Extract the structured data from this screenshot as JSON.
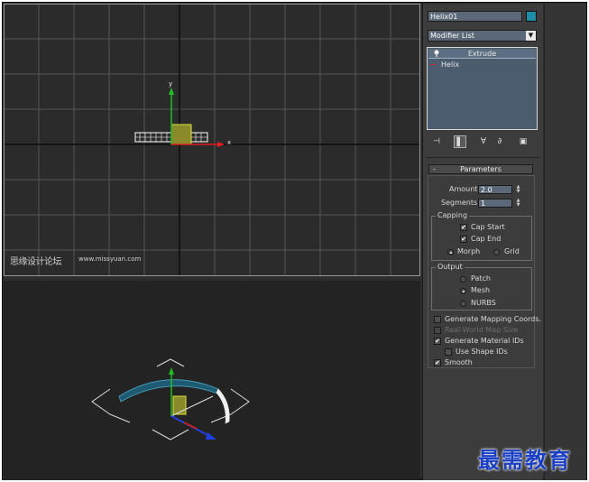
{
  "viewports": {
    "top": {
      "watermark_cn": "思缘设计论坛",
      "watermark_url": "www.missyuan.com",
      "axis_y": "y",
      "axis_x": "x"
    },
    "perspective": {}
  },
  "command_panel": {
    "object_name": "Helix01",
    "object_color": "#1f8da3",
    "modifier_list_label": "Modifier List",
    "stack": {
      "items": [
        {
          "label": "Extrude",
          "icon": "lightbulb-icon"
        },
        {
          "label": "Helix"
        }
      ]
    },
    "stack_tools": [
      {
        "icon": "pin-stack-icon"
      },
      {
        "icon": "show-end-result-icon"
      },
      {
        "icon": "make-unique-icon"
      },
      {
        "icon": "remove-modifier-icon"
      },
      {
        "icon": "configure-modifier-sets-icon"
      }
    ],
    "parameters": {
      "title": "Parameters",
      "collapse_symbol": "-",
      "amount_label": "Amount:",
      "amount_value": "2.0",
      "segments_label": "Segments:",
      "segments_value": "1",
      "capping": {
        "title": "Capping",
        "cap_start": "Cap Start",
        "cap_end": "Cap End",
        "morph": "Morph",
        "grid": "Grid"
      },
      "output": {
        "title": "Output",
        "patch": "Patch",
        "mesh": "Mesh",
        "nurbs": "NURBS"
      },
      "generate_mapping_coords": "Generate Mapping Coords.",
      "real_world_map_size": "Real-World Map Size",
      "generate_material_ids": "Generate Material IDs",
      "use_shape_ids": "Use Shape IDs",
      "smooth": "Smooth"
    }
  },
  "brand_watermark": "最需教育"
}
